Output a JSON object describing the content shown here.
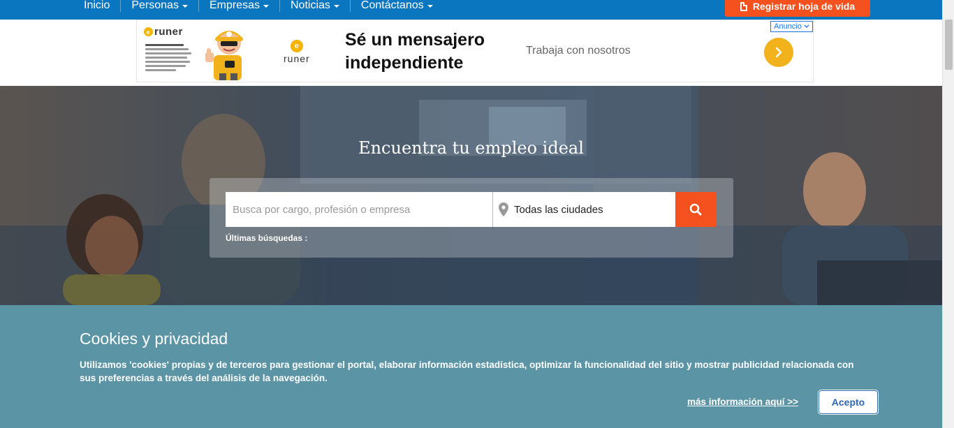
{
  "nav": {
    "items": [
      {
        "label": "Inicio",
        "has_caret": false
      },
      {
        "label": "Personas",
        "has_caret": true
      },
      {
        "label": "Empresas",
        "has_caret": true
      },
      {
        "label": "Noticias",
        "has_caret": true
      },
      {
        "label": "Contáctanos",
        "has_caret": true
      }
    ],
    "register_label": "Registrar hoja de vida",
    "register_icon": "document-icon"
  },
  "ad": {
    "badge": "Anuncio",
    "brand": "runer",
    "headline": "Sé un mensajero independiente",
    "subtext": "Trabaja con nosotros",
    "arrow_icon": "chevron-right-icon"
  },
  "hero": {
    "title": "Encuentra tu empleo ideal",
    "search_placeholder": "Busca por cargo, profesión o empresa",
    "city_value": "Todas las ciudades",
    "city_icon": "map-pin-icon",
    "search_icon": "search-icon",
    "last_searches_label": "Últimas búsquedas :"
  },
  "cookies": {
    "title": "Cookies y privacidad",
    "text": "Utilizamos 'cookies' propias y de terceros para gestionar el portal, elaborar información estadística, optimizar la funcionalidad del sitio y mostrar publicidad relacionada con sus preferencias a través del análisis de la navegación.",
    "more_info_link": "más información aquí >>",
    "accept_label": "Acepto"
  },
  "colors": {
    "nav_bg": "#0a76c0",
    "accent_orange": "#f4511e",
    "cookie_bg": "#5b95a5",
    "ad_yellow": "#f2b21c"
  }
}
